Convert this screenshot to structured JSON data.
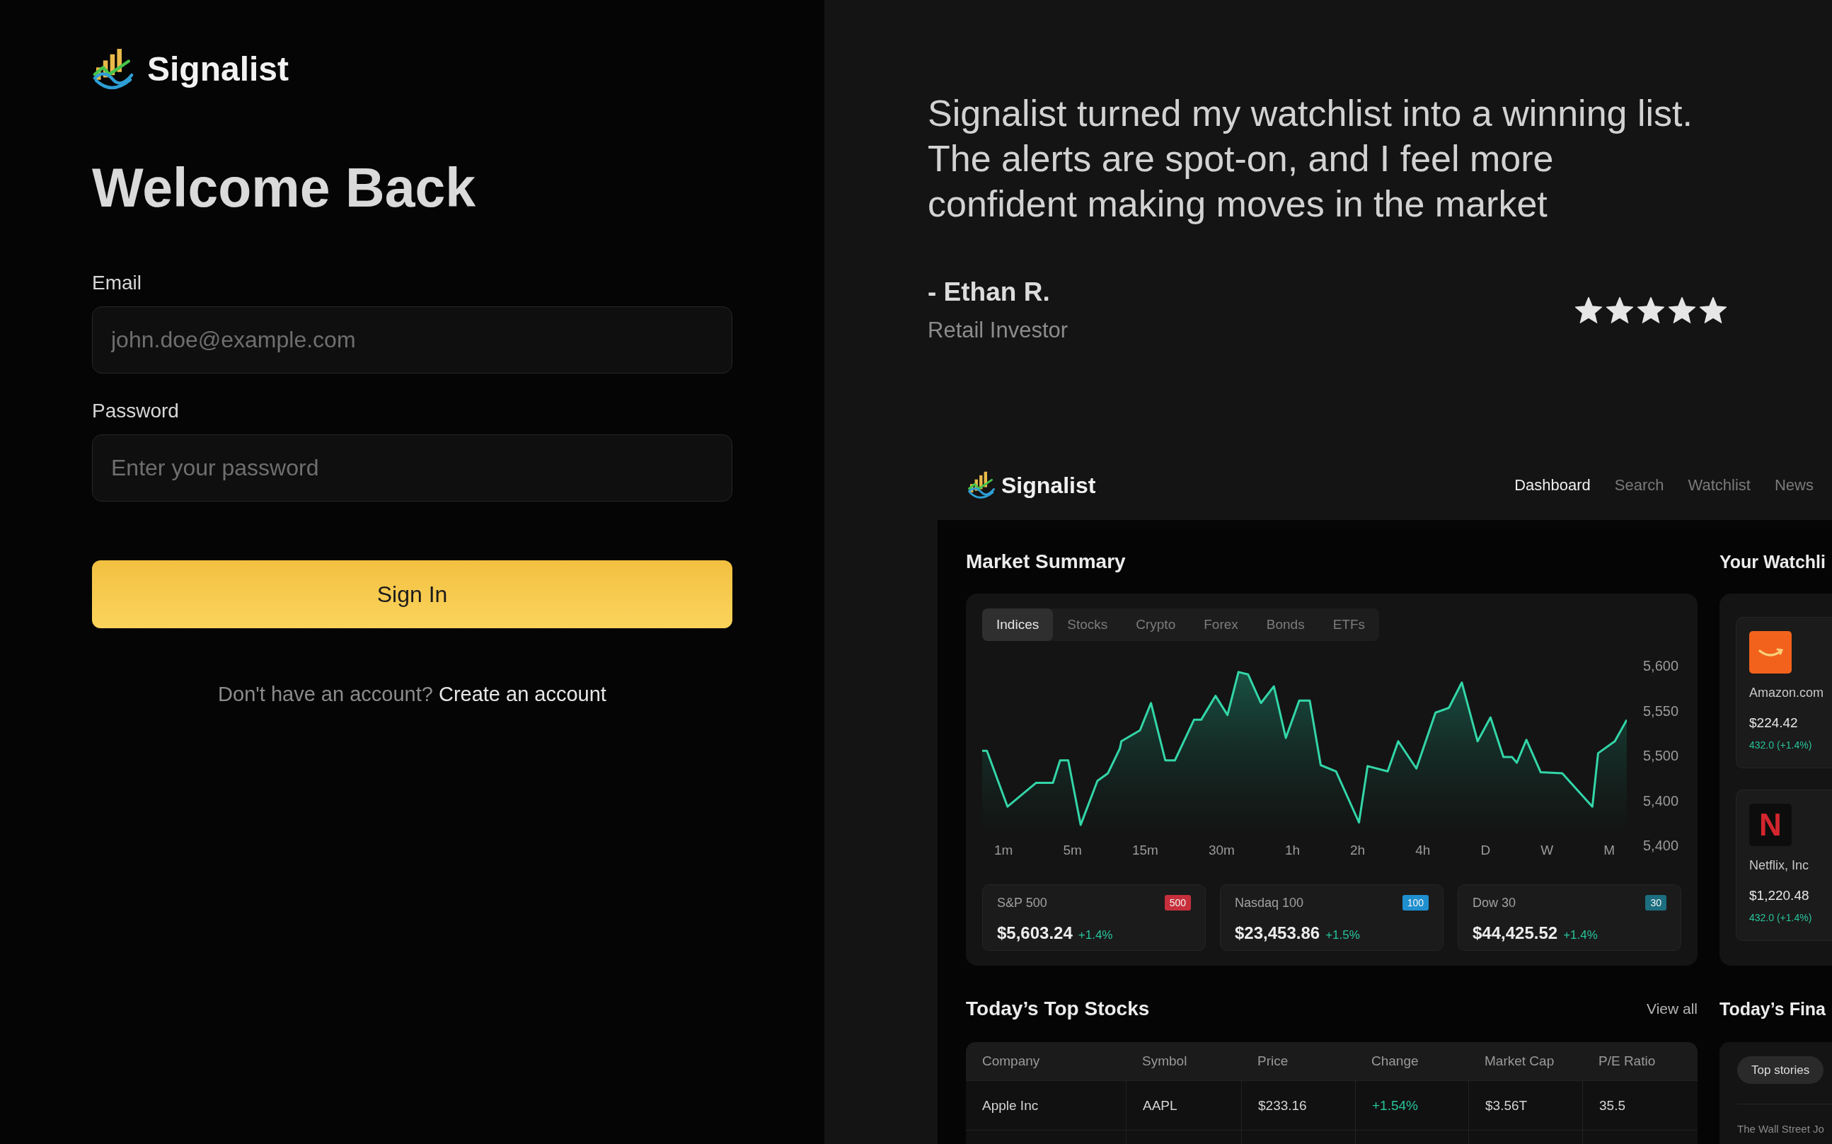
{
  "brand": {
    "name": "Signalist"
  },
  "login": {
    "title": "Welcome Back",
    "fields": [
      {
        "label": "Email",
        "placeholder": "john.doe@example.com"
      },
      {
        "label": "Password",
        "placeholder": "Enter your password"
      }
    ],
    "submit": "Sign In",
    "signup_prompt": {
      "text": "Don't have an account?",
      "link": "Create an account"
    }
  },
  "testimonial": {
    "quote": "Signalist turned my watchlist into a winning list. The alerts are spot-on, and I feel more confident making moves in the market",
    "author": "- Ethan R.",
    "role": "Retail Investor",
    "stars": 5
  },
  "dashboard_preview": {
    "brand": "Signalist",
    "nav": [
      {
        "label": "Dashboard",
        "selected": true
      },
      {
        "label": "Search",
        "selected": false
      },
      {
        "label": "Watchlist",
        "selected": false
      },
      {
        "label": "News",
        "selected": false
      }
    ],
    "market_summary": {
      "title": "Market Summary",
      "tabs": [
        {
          "label": "Indices",
          "selected": true
        },
        {
          "label": "Stocks",
          "selected": false
        },
        {
          "label": "Crypto",
          "selected": false
        },
        {
          "label": "Forex",
          "selected": false
        },
        {
          "label": "Bonds",
          "selected": false
        },
        {
          "label": "ETFs",
          "selected": false
        }
      ],
      "y_axis_labels": [
        "5,600",
        "5,550",
        "5,500",
        "5,400",
        "5,400"
      ],
      "x_axis_labels": [
        "1m",
        "5m",
        "15m",
        "30m",
        "1h",
        "2h",
        "4h",
        "D",
        "W",
        "M"
      ],
      "indices": [
        {
          "name": "S&P 500",
          "badge": "500",
          "color": "#c62f3b",
          "value": "$5,603.24",
          "change": "+1.4%"
        },
        {
          "name": "Nasdaq 100",
          "badge": "100",
          "color": "#1f8fcf",
          "value": "$23,453.86",
          "change": "+1.5%"
        },
        {
          "name": "Dow 30",
          "badge": "30",
          "color": "#1c6e80",
          "value": "$44,425.52",
          "change": "+1.4%"
        }
      ]
    },
    "top_stocks": {
      "title": "Today’s Top Stocks",
      "link": "View all",
      "columns": [
        "Company",
        "Symbol",
        "Price",
        "Change",
        "Market Cap",
        "P/E Ratio"
      ],
      "rows": [
        {
          "company": "Apple Inc",
          "symbol": "AAPL",
          "price": "$233.16",
          "change": "+1.54%",
          "market_cap": "$3.56T",
          "pe_ratio": "35.5"
        }
      ]
    },
    "watchlist": {
      "title": "Your Watchli",
      "items": [
        {
          "kind": "smile_logo",
          "name": "Amazon.com",
          "price": "$224.42",
          "change": "432.0 (+1.4%)"
        },
        {
          "kind": "letter_logo",
          "logo_text": "N",
          "name": "Netflix, Inc",
          "price": "$1,220.48",
          "change": "432.0 (+1.4%)"
        }
      ]
    },
    "news": {
      "title": "Today’s Fina",
      "tabs": [
        {
          "label": "Top stories",
          "selected": true
        }
      ],
      "source": "The Wall Street Jo"
    }
  }
}
